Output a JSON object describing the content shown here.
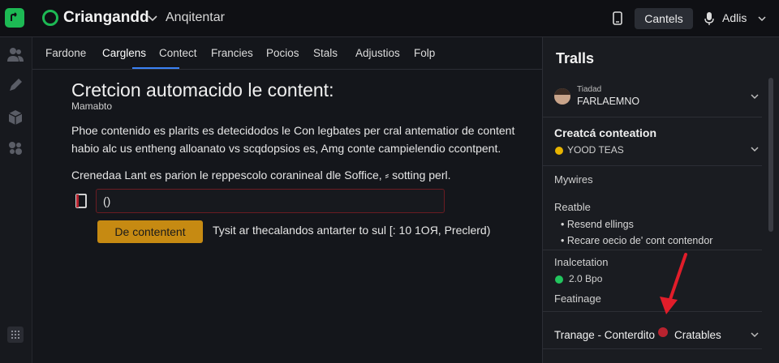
{
  "header": {
    "brand": "Criangandd",
    "breadcrumb": "Anqitentar",
    "action_button": "Cantels",
    "user_label": "Adlis"
  },
  "tabs": [
    {
      "label": "Fardone"
    },
    {
      "label": "Carglens",
      "active": true
    },
    {
      "label": "Contect"
    },
    {
      "label": "Francies"
    },
    {
      "label": "Pocios"
    },
    {
      "label": "Stals"
    },
    {
      "label": "Adjustios"
    },
    {
      "label": "Folp"
    }
  ],
  "main": {
    "title": "Cretcion automacido le content:",
    "subtitle": "Mamabto",
    "paragraph_1": "Phoe contenido es  plarits es detecidodos le Con legbates per cral antematior de content habio alc us entheng alloanato vs scqdopsios es, Amg conte campielendio ccontpent.",
    "paragraph_2": "Crenedaa Lant es parion le reppescolo coranineal dle Soffice, ⸗ sotting perl.",
    "input_value": "()",
    "primary_button": "De contentent",
    "button_hint": "Tysit ar thecalandos antarter to sul [: 10 1OЯ, Preclerd)"
  },
  "panel": {
    "title": "Tralls",
    "user": {
      "small": "Tiadad",
      "name": "FARLAEMNO"
    },
    "section_1": {
      "heading": "Creatcá conteation",
      "status": "YOOD TEAS",
      "status_color": "#e8b400"
    },
    "section_2": {
      "heading": "Mywires"
    },
    "section_3": {
      "heading": "Reatble",
      "items": [
        "Resend ellings",
        "Recare oecio de' cont contendor"
      ]
    },
    "section_4": {
      "heading": "Inalcetation",
      "status": "2.0 Bpo",
      "status_color": "#22c55e"
    },
    "section_5": {
      "heading": "Featinage"
    },
    "bottom_item": {
      "left": "Tranage - Conterdito",
      "right": "Cratables"
    }
  },
  "colors": {
    "accent_green": "#1db954",
    "tab_underline": "#3b82f6",
    "primary_button": "#c68a12",
    "annotation_arrow": "#e11d2a"
  }
}
